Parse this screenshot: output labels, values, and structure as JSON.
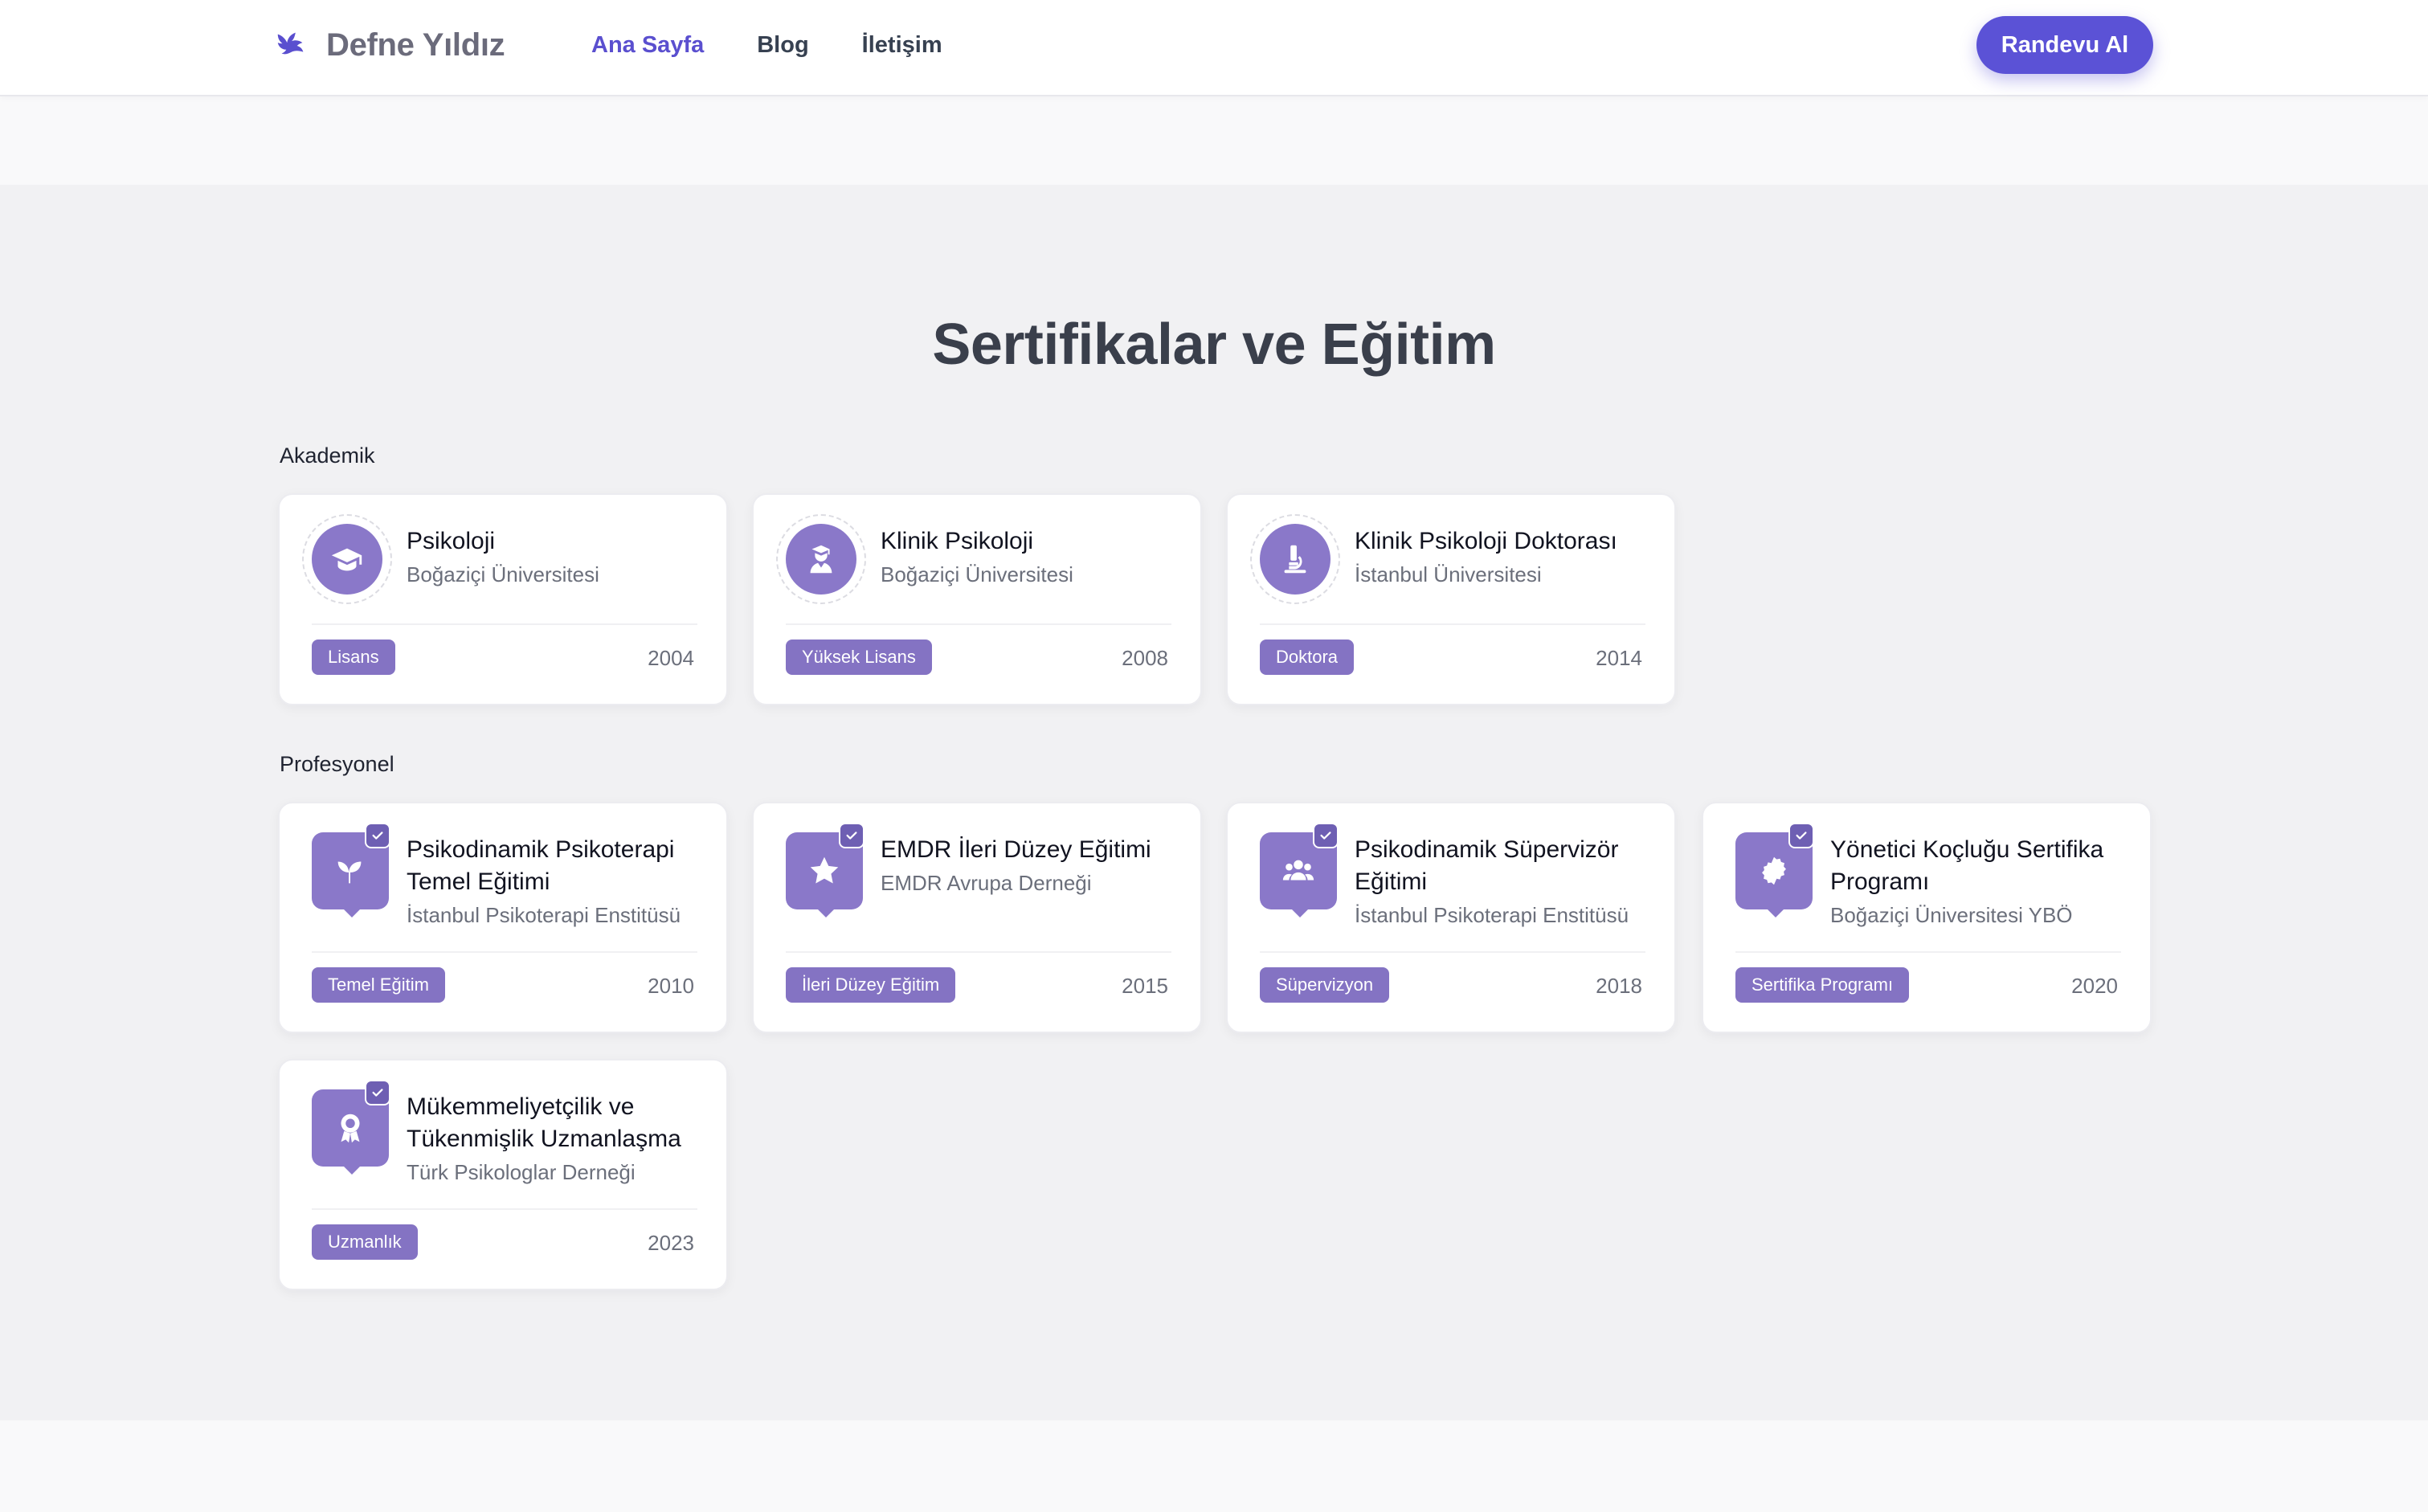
{
  "header": {
    "brand": "Defne Yıldız",
    "nav": [
      {
        "label": "Ana Sayfa",
        "active": true
      },
      {
        "label": "Blog",
        "active": false
      },
      {
        "label": "İletişim",
        "active": false
      }
    ],
    "cta_label": "Randevu Al",
    "accent_color": "#5b52d6"
  },
  "section": {
    "title": "Sertifikalar ve Eğitim",
    "academic_label": "Akademik",
    "professional_label": "Profesyonel",
    "icon_color": "#8a78c9",
    "academic": [
      {
        "title": "Psikoloji",
        "institution": "Boğaziçi Üniversitesi",
        "badge": "Lisans",
        "year": "2004",
        "icon": "graduation-cap-icon"
      },
      {
        "title": "Klinik Psikoloji",
        "institution": "Boğaziçi Üniversitesi",
        "badge": "Yüksek Lisans",
        "year": "2008",
        "icon": "graduate-user-icon"
      },
      {
        "title": "Klinik Psikoloji Doktorası",
        "institution": "İstanbul Üniversitesi",
        "badge": "Doktora",
        "year": "2014",
        "icon": "microscope-icon"
      }
    ],
    "professional": [
      {
        "title": "Psikodinamik Psikoterapi Temel Eğitimi",
        "institution": "İstanbul Psikoterapi Enstitüsü",
        "badge": "Temel Eğitim",
        "year": "2010",
        "icon": "seedling-icon"
      },
      {
        "title": "EMDR İleri Düzey Eğitimi",
        "institution": "EMDR Avrupa Derneği",
        "badge": "İleri Düzey Eğitim",
        "year": "2015",
        "icon": "star-icon"
      },
      {
        "title": "Psikodinamik Süpervizör Eğitimi",
        "institution": "İstanbul Psikoterapi Enstitüsü",
        "badge": "Süpervizyon",
        "year": "2018",
        "icon": "users-icon"
      },
      {
        "title": "Yönetici Koçluğu Sertifika Programı",
        "institution": "Boğaziçi Üniversitesi YBÖ",
        "badge": "Sertifika Programı",
        "year": "2020",
        "icon": "certificate-icon"
      },
      {
        "title": "Mükemmeliyetçilik ve Tükenmişlik Uzmanlaşma",
        "institution": "Türk Psikologlar Derneği",
        "badge": "Uzmanlık",
        "year": "2023",
        "icon": "award-icon"
      }
    ]
  }
}
